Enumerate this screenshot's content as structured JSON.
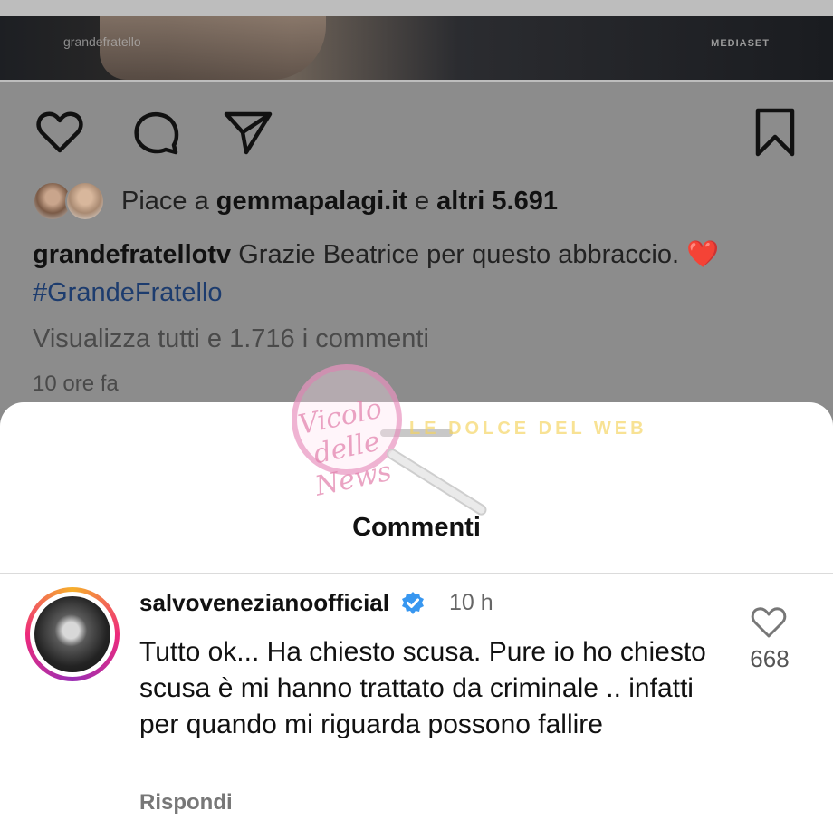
{
  "media": {
    "watermark_text": "grandefratello",
    "logo_text": "MEDIASET"
  },
  "post": {
    "likes": {
      "prefix": "Piace a ",
      "user": "gemmapalagi.it",
      "middle": " e ",
      "count": "altri 5.691"
    },
    "caption": {
      "username": "grandefratellotv",
      "text": " Grazie Beatrice per questo abbraccio. ",
      "emoji": "❤️",
      "hashtag": "#GrandeFratello"
    },
    "view_all_comments": "Visualizza tutti e 1.716 i commenti",
    "time_ago": "10 ore fa",
    "icons": [
      "heart-icon",
      "comment-icon",
      "share-icon",
      "bookmark-icon"
    ]
  },
  "sheet": {
    "title": "Commenti",
    "comment": {
      "username": "salvovenezianoofficial",
      "time": "10 h",
      "text": "Tutto ok... Ha chiesto scusa. Pure io ho chiesto scusa è mi hanno trattato da criminale .. infatti per quando mi riguarda possono fallire",
      "reply_label": "Rispondi",
      "like_count": "668"
    }
  },
  "watermark": {
    "logo_text": "Vicolo delle News",
    "right_text": "LE DOLCE DEL WEB"
  },
  "colors": {
    "verified_blue": "#3897f0",
    "heart_red": "#a41318",
    "hashtag_blue": "#1d3c6e"
  }
}
